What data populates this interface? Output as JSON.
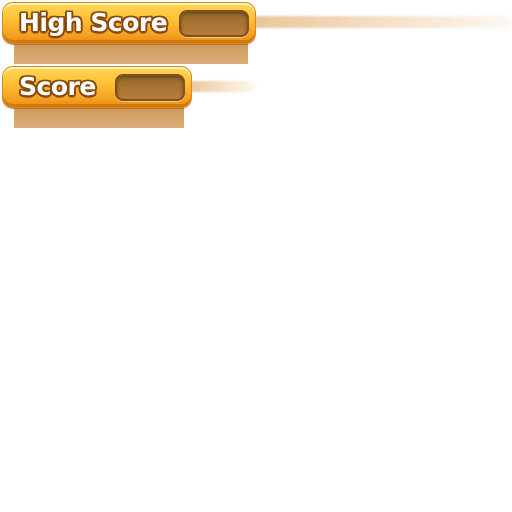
{
  "hud": {
    "high_score": {
      "label": "High Score",
      "value": ""
    },
    "score": {
      "label": "Score",
      "value": ""
    }
  },
  "colors": {
    "panel_top": "#ffd95a",
    "panel_bottom": "#e58c17",
    "slot_fill": "#a8722f",
    "label_text": "#ffffff",
    "label_outline": "#8a4a0c"
  }
}
